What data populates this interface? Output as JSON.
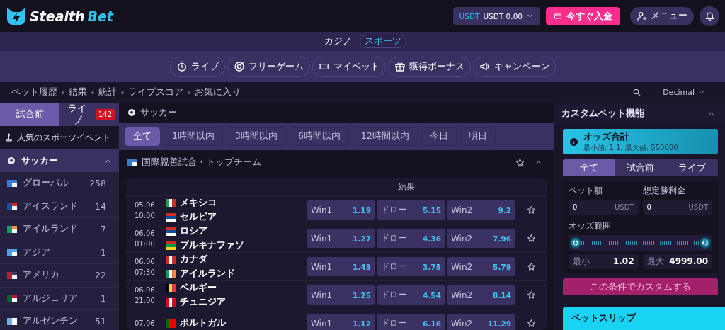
{
  "header": {
    "logo": [
      "Stealth",
      "Bet"
    ],
    "wallet": {
      "currency": "USDT",
      "balance": "USDT 0.00"
    },
    "deposit": "今すぐ入金",
    "menu": "メニュー"
  },
  "categories": [
    {
      "label": "カジノ",
      "selected": false
    },
    {
      "label": "スポーツ",
      "selected": true
    }
  ],
  "nav": [
    "ライブ",
    "フリーゲーム",
    "マイベット",
    "獲得ボーナス",
    "キャンペーン"
  ],
  "breadcrumbs": [
    "ベット履歴",
    "結果",
    "統計",
    "ライブスコア",
    "お気に入り"
  ],
  "odds_format": "Decimal",
  "sidebar": {
    "tabs": [
      {
        "label": "試合前",
        "selected": true
      },
      {
        "label": "ライブ",
        "selected": false,
        "badge": "142"
      }
    ],
    "popular": "人気のスポーツイベント",
    "sport": {
      "label": "サッカー",
      "expanded": true
    },
    "regions": [
      {
        "name": "グローバル",
        "count": "258"
      },
      {
        "name": "アイスランド",
        "count": "14"
      },
      {
        "name": "アイルランド",
        "count": "7"
      },
      {
        "name": "アジア",
        "count": "1"
      },
      {
        "name": "アメリカ",
        "count": "22"
      },
      {
        "name": "アルジェリア",
        "count": "1"
      },
      {
        "name": "アルゼンチン",
        "count": "51"
      }
    ]
  },
  "main": {
    "sport": "サッカー",
    "filters": [
      {
        "label": "全て",
        "selected": true
      },
      {
        "label": "1時間以内",
        "selected": false
      },
      {
        "label": "3時間以内",
        "selected": false
      },
      {
        "label": "6時間以内",
        "selected": false
      },
      {
        "label": "12時間以内",
        "selected": false
      },
      {
        "label": "今日",
        "selected": false
      },
      {
        "label": "明日",
        "selected": false
      }
    ],
    "league": "国際親善試合・トップチーム",
    "market": "結果",
    "matches": [
      {
        "date": "05.06",
        "time": "10:00",
        "home": "メキシコ",
        "away": "セルビア",
        "odds": [
          {
            "label": "Win1",
            "value": "1.19"
          },
          {
            "label": "ドロー",
            "value": "5.15"
          },
          {
            "label": "Win2",
            "value": "9.2"
          }
        ]
      },
      {
        "date": "06.06",
        "time": "01:00",
        "home": "ロシア",
        "away": "ブルキナファソ",
        "odds": [
          {
            "label": "Win1",
            "value": "1.27"
          },
          {
            "label": "ドロー",
            "value": "4.36"
          },
          {
            "label": "Win2",
            "value": "7.96"
          }
        ]
      },
      {
        "date": "06.06",
        "time": "07:30",
        "home": "カナダ",
        "away": "アイルランド",
        "odds": [
          {
            "label": "Win1",
            "value": "1.43"
          },
          {
            "label": "ドロー",
            "value": "3.75"
          },
          {
            "label": "Win2",
            "value": "5.79"
          }
        ]
      },
      {
        "date": "06.06",
        "time": "21:00",
        "home": "ベルギー",
        "away": "チュニジア",
        "odds": [
          {
            "label": "Win1",
            "value": "1.25"
          },
          {
            "label": "ドロー",
            "value": "4.54"
          },
          {
            "label": "Win2",
            "value": "8.14"
          }
        ]
      },
      {
        "date": "07.06",
        "home": "ポルトガル",
        "odds": [
          {
            "label": "Win1",
            "value": "1.12"
          },
          {
            "label": "ドロー",
            "value": "6.16"
          },
          {
            "label": "Win2",
            "value": "11.29"
          }
        ]
      }
    ]
  },
  "custom": {
    "title": "カスタムベット機能",
    "expanded": true,
    "info": {
      "title": "オッズ合計",
      "text": "最小値: 1.1, 最大値: 550000"
    },
    "tabs": [
      {
        "label": "全て",
        "selected": true
      },
      {
        "label": "試合前",
        "selected": false
      },
      {
        "label": "ライブ",
        "selected": false
      }
    ],
    "stake": {
      "label": "ベット額",
      "value": "0",
      "unit": "USDT"
    },
    "payout": {
      "label": "想定勝利金",
      "value": "0",
      "unit": "USDT"
    },
    "range": {
      "label": "オッズ範囲",
      "thumbs": [
        {
          "level": 0
        },
        {
          "level": 1
        }
      ],
      "min": {
        "label": "最小",
        "value": "1.02"
      },
      "max": {
        "label": "最大",
        "value": "4999.00"
      }
    },
    "submit": "この条件でカスタムする"
  },
  "betslip": {
    "title": "ベットスリップ"
  }
}
